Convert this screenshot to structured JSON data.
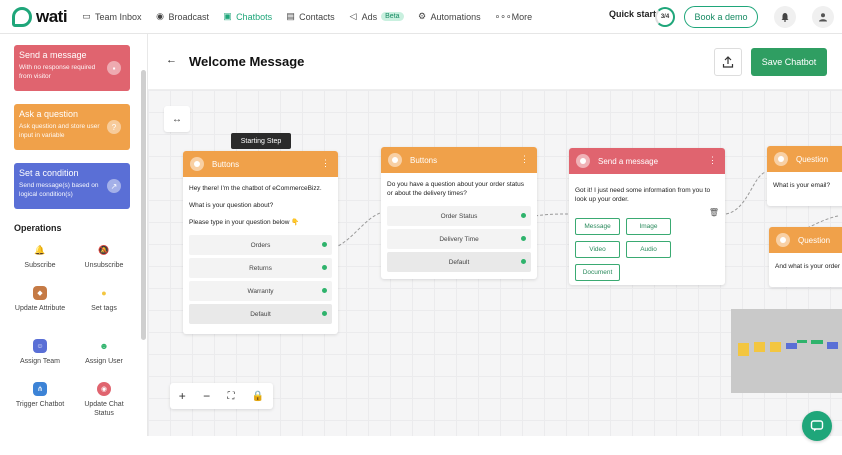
{
  "nav": {
    "logo": "wati",
    "items": [
      {
        "label": "Team Inbox",
        "icon": "inbox-icon"
      },
      {
        "label": "Broadcast",
        "icon": "broadcast-icon"
      },
      {
        "label": "Chatbots",
        "icon": "chatbot-icon"
      },
      {
        "label": "Contacts",
        "icon": "contacts-icon"
      },
      {
        "label": "Ads",
        "icon": "megaphone-icon"
      },
      {
        "label": "Automations",
        "icon": "gear-icon"
      },
      {
        "label": "More",
        "icon": "dots-icon"
      }
    ],
    "ads_badge": "Beta",
    "quick_start": "Quick start",
    "quick_start_progress": "3/4",
    "book_demo": "Book a demo",
    "accent": "#1fa67a"
  },
  "sidebar": {
    "blocks": [
      {
        "title": "Send a message",
        "desc": "With no response required from visitor",
        "color": "#e0646f"
      },
      {
        "title": "Ask a question",
        "desc": "Ask question and store user input in variable",
        "color": "#f0a14a"
      },
      {
        "title": "Set a condition",
        "desc": "Send message(s) based on logical condition(s)",
        "color": "#5a6fd6"
      }
    ],
    "operations_title": "Operations",
    "operations": [
      {
        "label": "Subscribe"
      },
      {
        "label": "Unsubscribe"
      },
      {
        "label": "Update Attribute"
      },
      {
        "label": "Set tags"
      },
      {
        "label": "Assign Team"
      },
      {
        "label": "Assign User"
      },
      {
        "label": "Trigger Chatbot"
      },
      {
        "label": "Update Chat Status"
      }
    ]
  },
  "header": {
    "title": "Welcome Message",
    "save_label": "Save Chatbot"
  },
  "canvas": {
    "starting_step": "Starting Step",
    "nodes": {
      "buttons1": {
        "title": "Buttons",
        "text1": "Hey there! I'm the chatbot of eCommerceBizz.",
        "text2": "What is your question about?",
        "text3": "Please type in your question below 👇",
        "options": [
          "Orders",
          "Returns",
          "Warranty",
          "Default"
        ]
      },
      "buttons2": {
        "title": "Buttons",
        "text": "Do you have a question about your order status or about the delivery times?",
        "options": [
          "Order Status",
          "Delivery Time",
          "Default"
        ]
      },
      "send_message": {
        "title": "Send a message",
        "text": "Got it! I just need some information from you to look up your order.",
        "media": [
          "Message",
          "Image",
          "Video",
          "Audio",
          "Document"
        ]
      },
      "question1": {
        "title": "Question",
        "text": "What is your email?"
      },
      "question2": {
        "title": "Question",
        "text": "And what is your order"
      }
    }
  },
  "colors": {
    "green_header": "#f0a14a",
    "send_header": "#e0646f",
    "save_button": "#2f9e62"
  }
}
